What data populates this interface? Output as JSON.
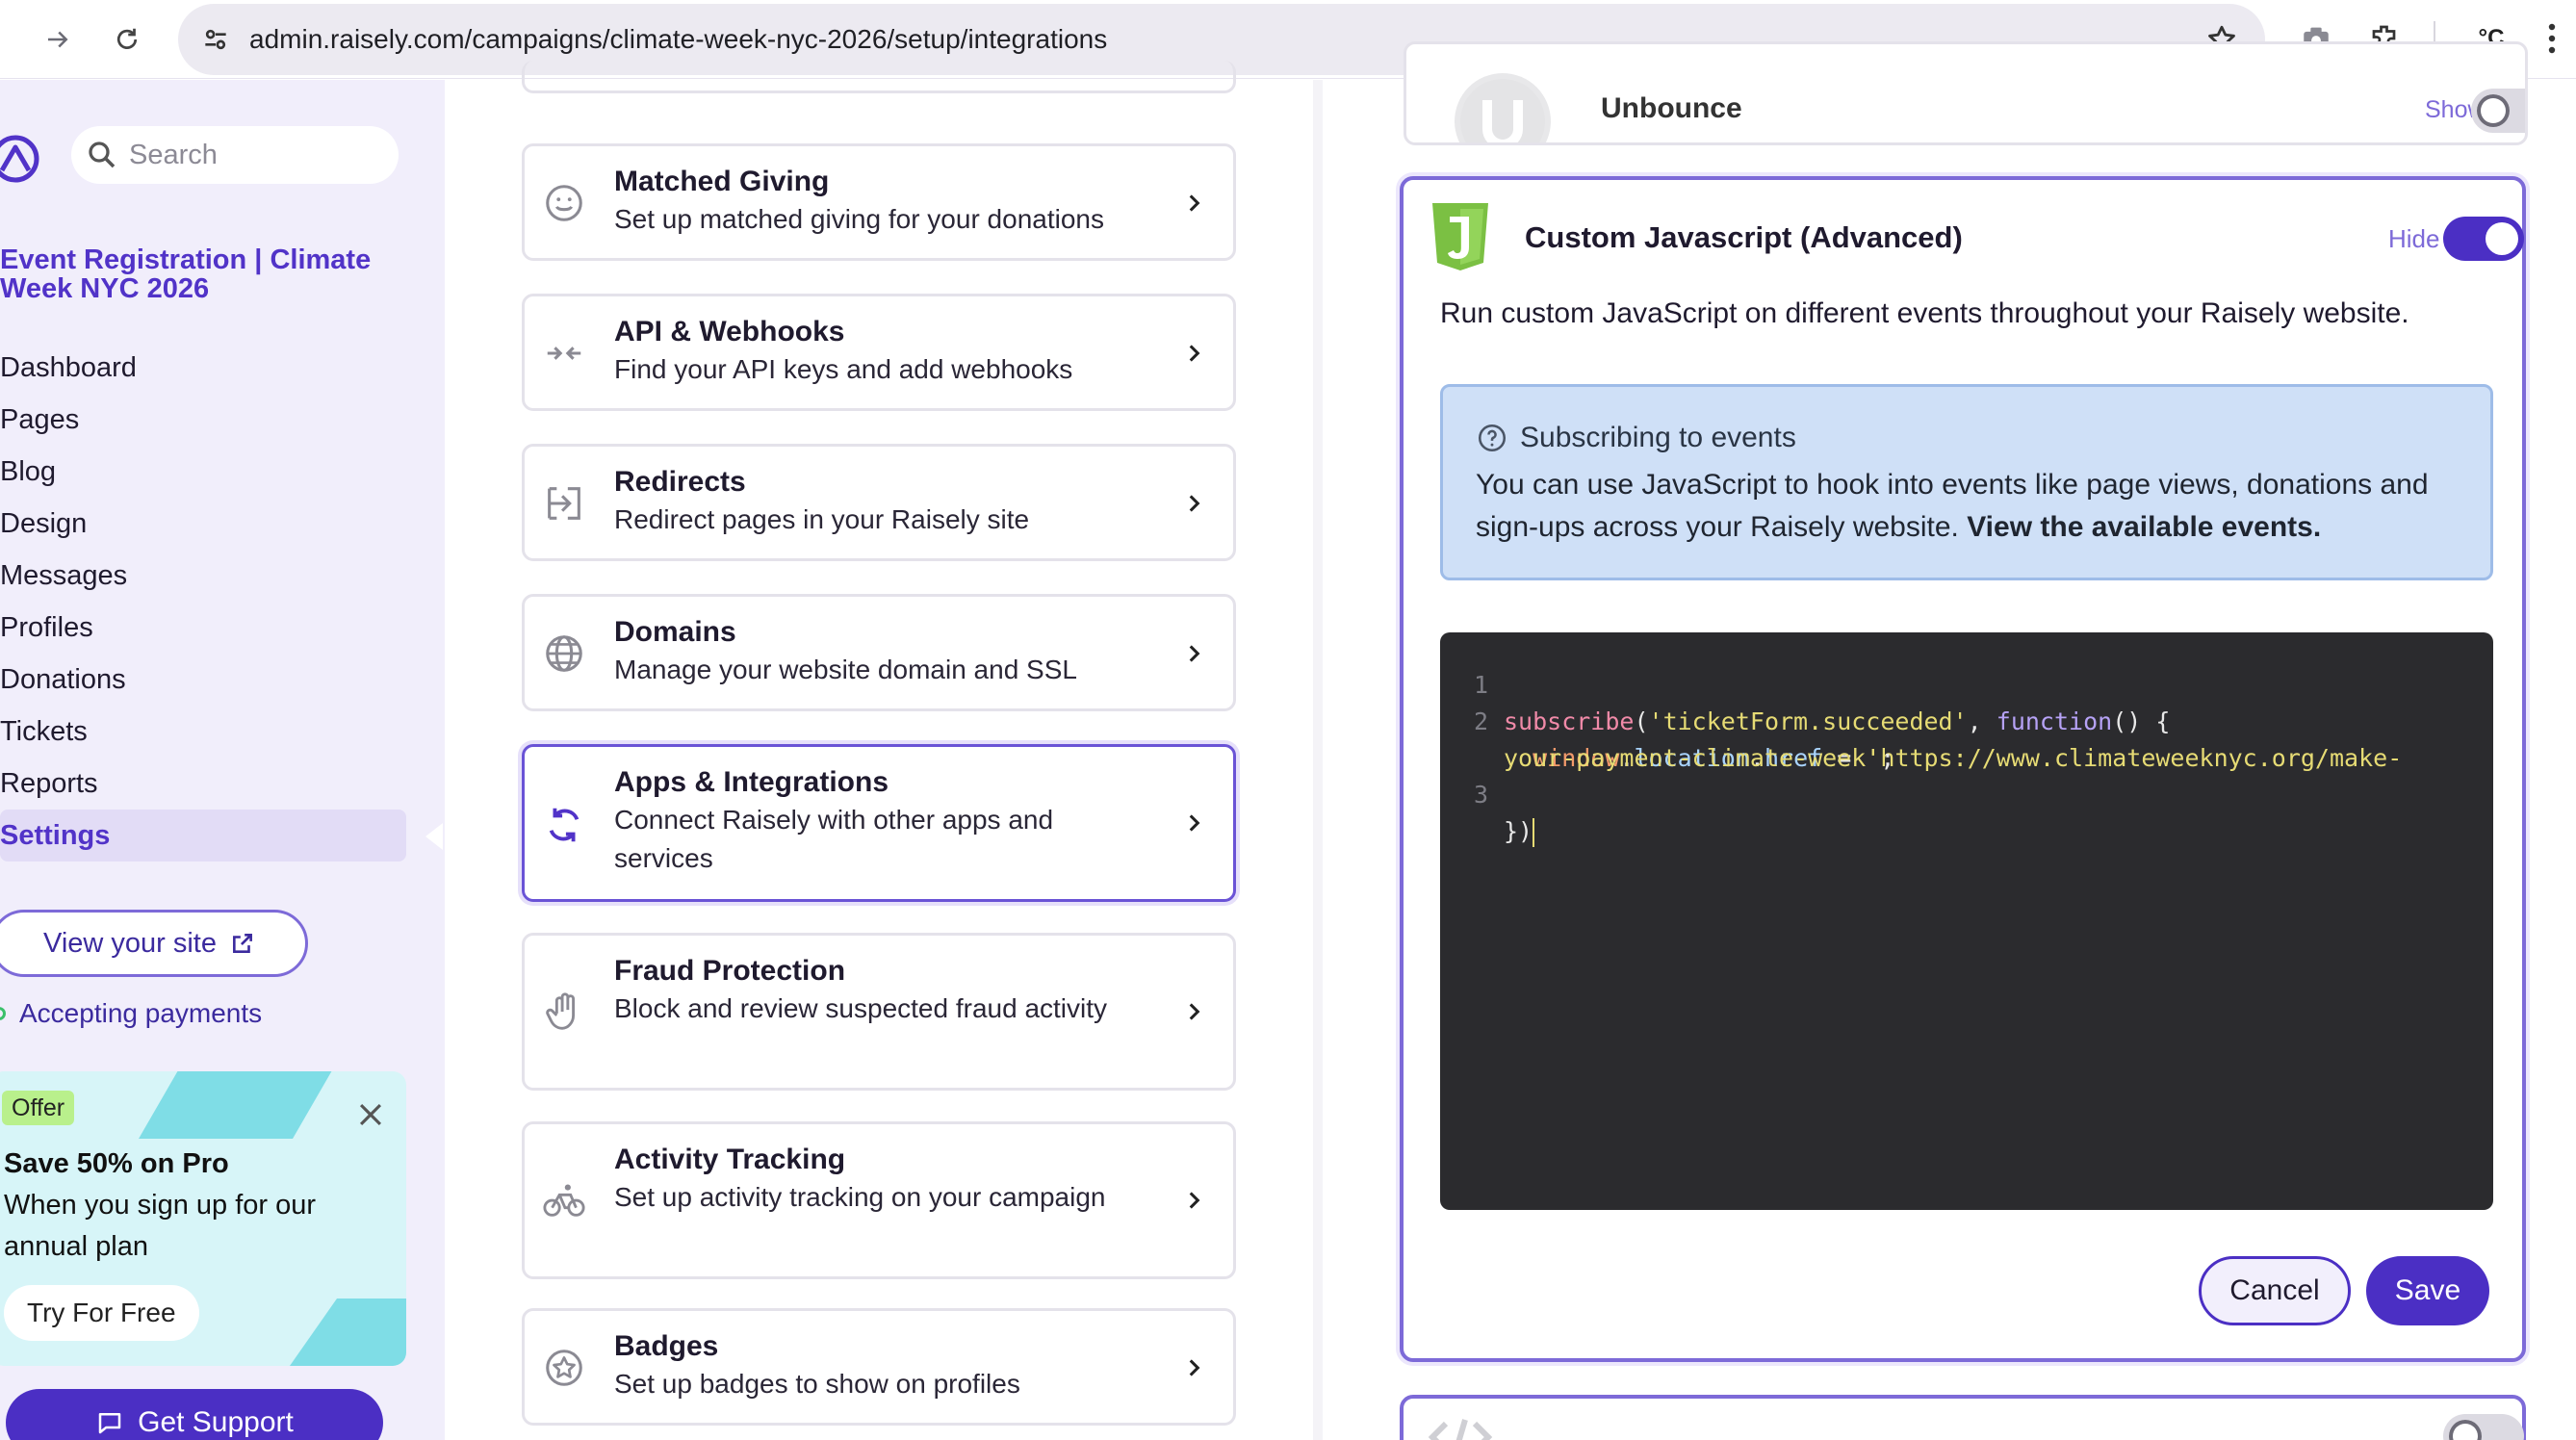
{
  "browser": {
    "url": "admin.raisely.com/campaigns/climate-week-nyc-2026/setup/integrations",
    "ext_label": "°C"
  },
  "sidebar": {
    "search_placeholder": "Search",
    "campaign_title": "Event Registration | Climate Week NYC 2026",
    "nav": [
      "Dashboard",
      "Pages",
      "Blog",
      "Design",
      "Messages",
      "Profiles",
      "Donations",
      "Tickets",
      "Reports",
      "Settings"
    ],
    "active_item": "Settings",
    "view_site": "View your site",
    "accepting": "Accepting payments",
    "promo": {
      "badge": "Offer",
      "title": "Save 50% on Pro",
      "desc": "When you sign up for our annual plan",
      "cta": "Try For Free"
    },
    "support": "Get Support"
  },
  "settings_list": [
    {
      "title": "Matched Giving",
      "desc": "Set up matched giving for your donations",
      "icon": "smile-icon"
    },
    {
      "title": "API & Webhooks",
      "desc": "Find your API keys and add webhooks",
      "icon": "arrows-in-icon"
    },
    {
      "title": "Redirects",
      "desc": "Redirect pages in your Raisely site",
      "icon": "redirect-icon"
    },
    {
      "title": "Domains",
      "desc": "Manage your website domain and SSL",
      "icon": "globe-icon"
    },
    {
      "title": "Apps & Integrations",
      "desc": "Connect Raisely with other apps and services",
      "icon": "sync-icon",
      "selected": true
    },
    {
      "title": "Fraud Protection",
      "desc": "Block and review suspected fraud activity",
      "icon": "hand-icon"
    },
    {
      "title": "Activity Tracking",
      "desc": "Set up activity tracking on your campaign",
      "icon": "bike-icon"
    },
    {
      "title": "Badges",
      "desc": "Set up badges to show on profiles",
      "icon": "badge-icon"
    }
  ],
  "integrations": {
    "unbounce": {
      "name": "Unbounce",
      "toggle_label": "Show",
      "enabled": false
    },
    "custom_js": {
      "name": "Custom Javascript (Advanced)",
      "toggle_label": "Hide",
      "enabled": true,
      "description": "Run custom JavaScript on different events throughout your Raisely website.",
      "info": {
        "title": "Subscribing to events",
        "text": "You can use JavaScript to hook into events like page views, donations and sign-ups across your Raisely website.",
        "link": "View the available events."
      },
      "code_line_numbers": [
        "1",
        "2",
        "3"
      ],
      "code": {
        "l1_fn": "subscribe",
        "l1_str": "'ticketForm.succeeded'",
        "l1_kw": "function",
        "l2_var": "window",
        "l2_prop1": "location",
        "l2_prop2": "href",
        "l2_str_a": "'https://www.climateweeknyc.org/make-",
        "l2_str_b": "your-payment-climate-week'",
        "l3": "})"
      },
      "cancel": "Cancel",
      "save": "Save"
    }
  },
  "colors": {
    "brand": "#4b2fc4",
    "accent": "#7d6ad8",
    "sidebar_bg": "#f1eefb",
    "info_bg": "#cfe0f7",
    "code_bg": "#2b2b2e"
  }
}
